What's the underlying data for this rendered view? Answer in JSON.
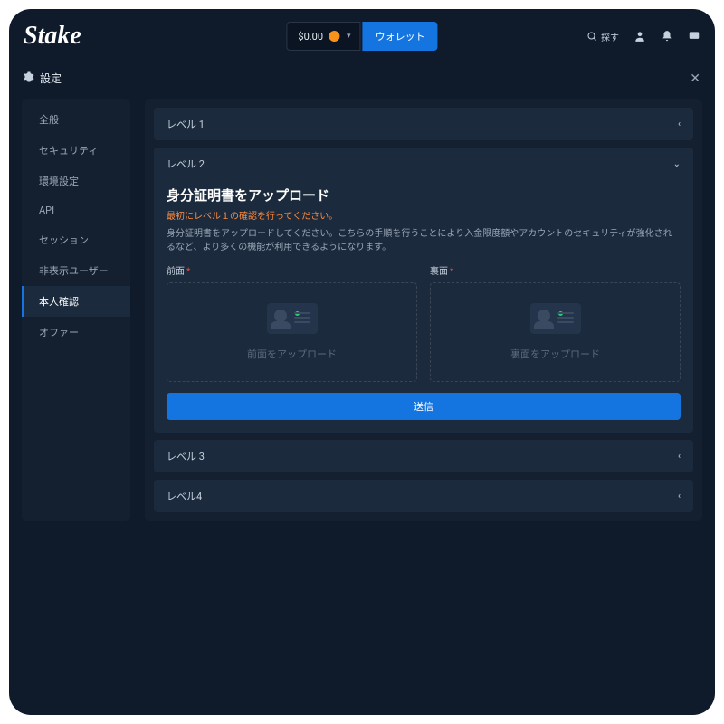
{
  "header": {
    "logo": "Stake",
    "balance": "$0.00",
    "wallet_button": "ウォレット",
    "search_label": "探す"
  },
  "settings_bar": {
    "title": "設定"
  },
  "sidebar": {
    "items": [
      {
        "label": "全般"
      },
      {
        "label": "セキュリティ"
      },
      {
        "label": "環境設定"
      },
      {
        "label": "API"
      },
      {
        "label": "セッション"
      },
      {
        "label": "非表示ユーザー"
      },
      {
        "label": "本人確認"
      },
      {
        "label": "オファー"
      }
    ]
  },
  "levels": {
    "l1": "レベル 1",
    "l2": "レベル 2",
    "l3": "レベル 3",
    "l4": "レベル4"
  },
  "level2": {
    "title": "身分証明書をアップロード",
    "warning": "最初にレベル１の確認を行ってください。",
    "description": "身分証明書をアップロードしてください。こちらの手順を行うことにより入金限度額やアカウントのセキュリティが強化されるなど、より多くの機能が利用できるようになります。",
    "front_label": "前面",
    "back_label": "裏面",
    "front_button": "前面をアップロード",
    "back_button": "裏面をアップロード",
    "submit_label": "送信"
  },
  "colors": {
    "accent": "#1475e1",
    "warn": "#ff8a3d",
    "bg": "#0f1a2b"
  }
}
